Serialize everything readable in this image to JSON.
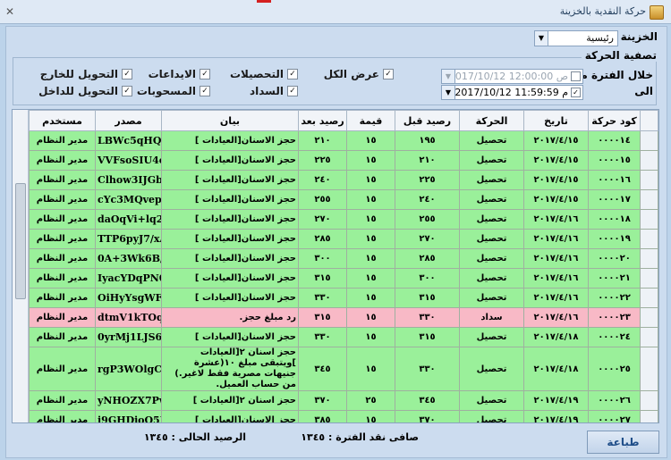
{
  "window": {
    "title": "حركة النقدية بالخزينة"
  },
  "treasury": {
    "label": "الخزينة :",
    "value": "رئيسية"
  },
  "filter": {
    "title": "تصفية الحركة",
    "show_all": "عرض الكل",
    "collections": "التحصيلات",
    "deposits": "الايداعات",
    "transfer_out": "التحويل للخارج",
    "payment": "السداد",
    "withdrawals": "المسحوبات",
    "transfer_in": "التحويل للداخل"
  },
  "period": {
    "from_label": "خلال الفترة من",
    "to_label": "الى",
    "from_value": "2017/10/12   12:00:00 ص",
    "to_value": "2017/10/12   11:59:59 م"
  },
  "table": {
    "headers": [
      "كود حركة",
      "تاريخ",
      "الحركة",
      "رصيد قبل",
      "قيمة",
      "رصيد بعد",
      "بيان",
      "مصدر",
      "مستخدم"
    ],
    "rows": [
      [
        "٠٠٠٠١٤",
        "٢٠١٧/٤/١٥",
        "تحصيل",
        "١٩٥",
        "١٥",
        "٢١٠",
        "حجز الاسنان[العيادات ]",
        "LBWc5qHQc",
        "مدير النظام"
      ],
      [
        "٠٠٠٠١٥",
        "٢٠١٧/٤/١٥",
        "تحصيل",
        "٢١٠",
        "١٥",
        "٢٢٥",
        "حجز الاسنان[العيادات ]",
        "VVFsoSIU4o",
        "مدير النظام"
      ],
      [
        "٠٠٠٠١٦",
        "٢٠١٧/٤/١٥",
        "تحصيل",
        "٢٢٥",
        "١٥",
        "٢٤٠",
        "حجز الاسنان[العيادات ]",
        "Clhow3IJGbw",
        "مدير النظام"
      ],
      [
        "٠٠٠٠١٧",
        "٢٠١٧/٤/١٥",
        "تحصيل",
        "٢٤٠",
        "١٥",
        "٢٥٥",
        "حجز الاسنان[العيادات ]",
        "cYc3MQvep0",
        "مدير النظام"
      ],
      [
        "٠٠٠٠١٨",
        "٢٠١٧/٤/١٦",
        "تحصيل",
        "٢٥٥",
        "١٥",
        "٢٧٠",
        "حجز الاسنان[العيادات ]",
        "daOqVi+lq2I",
        "مدير النظام"
      ],
      [
        "٠٠٠٠١٩",
        "٢٠١٧/٤/١٦",
        "تحصيل",
        "٢٧٠",
        "١٥",
        "٢٨٥",
        "حجز الاسنان[العيادات ]",
        "TTP6pyJ7/xA",
        "مدير النظام"
      ],
      [
        "٠٠٠٠٢٠",
        "٢٠١٧/٤/١٦",
        "تحصيل",
        "٢٨٥",
        "١٥",
        "٣٠٠",
        "حجز الاسنان[العيادات ]",
        "0A+3Wk6B/Q",
        "مدير النظام"
      ],
      [
        "٠٠٠٠٢١",
        "٢٠١٧/٤/١٦",
        "تحصيل",
        "٣٠٠",
        "١٥",
        "٣١٥",
        "حجز الاسنان[العيادات ]",
        "IyacYDqPN0",
        "مدير النظام"
      ],
      [
        "٠٠٠٠٢٢",
        "٢٠١٧/٤/١٦",
        "تحصيل",
        "٣١٥",
        "١٥",
        "٣٣٠",
        "حجز الاسنان[العيادات ]",
        "OiHyYsgWFk",
        "مدير النظام"
      ],
      [
        "٠٠٠٠٢٣",
        "٢٠١٧/٤/١٦",
        "سداد",
        "٣٣٠",
        "١٥",
        "٣١٥",
        "رد مبلغ حجز.",
        "dtmV1kTOq4",
        "مدير النظام"
      ],
      [
        "٠٠٠٠٢٤",
        "٢٠١٧/٤/١٨",
        "تحصيل",
        "٣١٥",
        "١٥",
        "٣٣٠",
        "حجز الاسنان[العيادات ]",
        "0yrMj1LJS6E",
        "مدير النظام"
      ],
      [
        "٠٠٠٠٢٥",
        "٢٠١٧/٤/١٨",
        "تحصيل",
        "٣٣٠",
        "١٥",
        "٣٤٥",
        "حجز اسنان ٢[العيادات ]ويتبقى مبلغ ١٠(عشرة جنيهات مصرية فقط لاغير.) من حساب العميل.",
        "rgP3WOlgCw",
        "مدير النظام"
      ],
      [
        "٠٠٠٠٢٦",
        "٢٠١٧/٤/١٩",
        "تحصيل",
        "٣٤٥",
        "٢٥",
        "٣٧٠",
        "حجز اسنان ٢[العيادات ]",
        "yNHOZX7Pw",
        "مدير النظام"
      ],
      [
        "٠٠٠٠٢٧",
        "٢٠١٧/٤/١٩",
        "تحصيل",
        "٣٧٠",
        "١٥",
        "٣٨٥",
        "حجز الاسنان[العيادات ]",
        "i9GHDjoQ5U",
        "مدير النظام"
      ]
    ],
    "row_types": [
      "g",
      "g",
      "g",
      "g",
      "g",
      "g",
      "g",
      "g",
      "g",
      "p",
      "g",
      "g",
      "g",
      "g"
    ]
  },
  "footer": {
    "net_label": "صافى نقد الفترة : ١٣٤٥",
    "balance_label": "الرصيد الحالى : ١٣٤٥",
    "print_label": "طباعة"
  }
}
